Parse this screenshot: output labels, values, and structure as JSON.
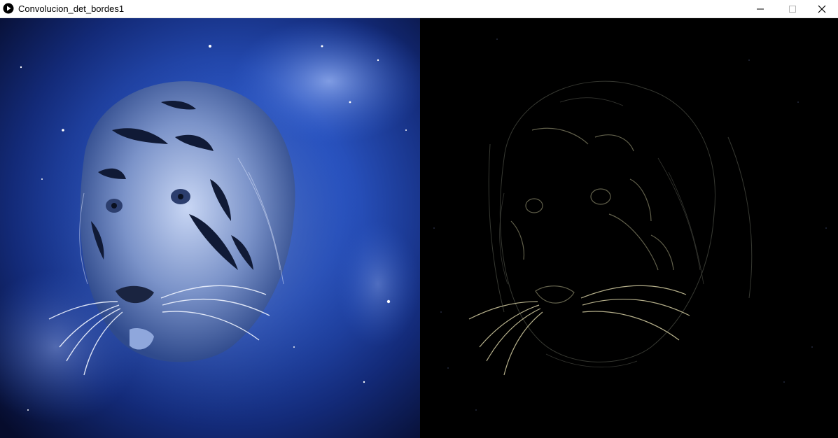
{
  "window": {
    "title": "Convolucion_det_bordes1",
    "app_icon": "play-icon",
    "controls": {
      "minimize_icon": "minimize-icon",
      "maximize_icon": "maximize-icon",
      "close_icon": "close-icon"
    }
  },
  "canvas": {
    "left_panel": {
      "content": "original-tiger-image",
      "colors": {
        "background": "#0b1a4a",
        "accent": "#3d6fe0",
        "highlight": "#dfe8ff"
      }
    },
    "right_panel": {
      "content": "edge-detected-tiger-image",
      "colors": {
        "background": "#000000",
        "edges": "#b8b48a"
      }
    }
  }
}
